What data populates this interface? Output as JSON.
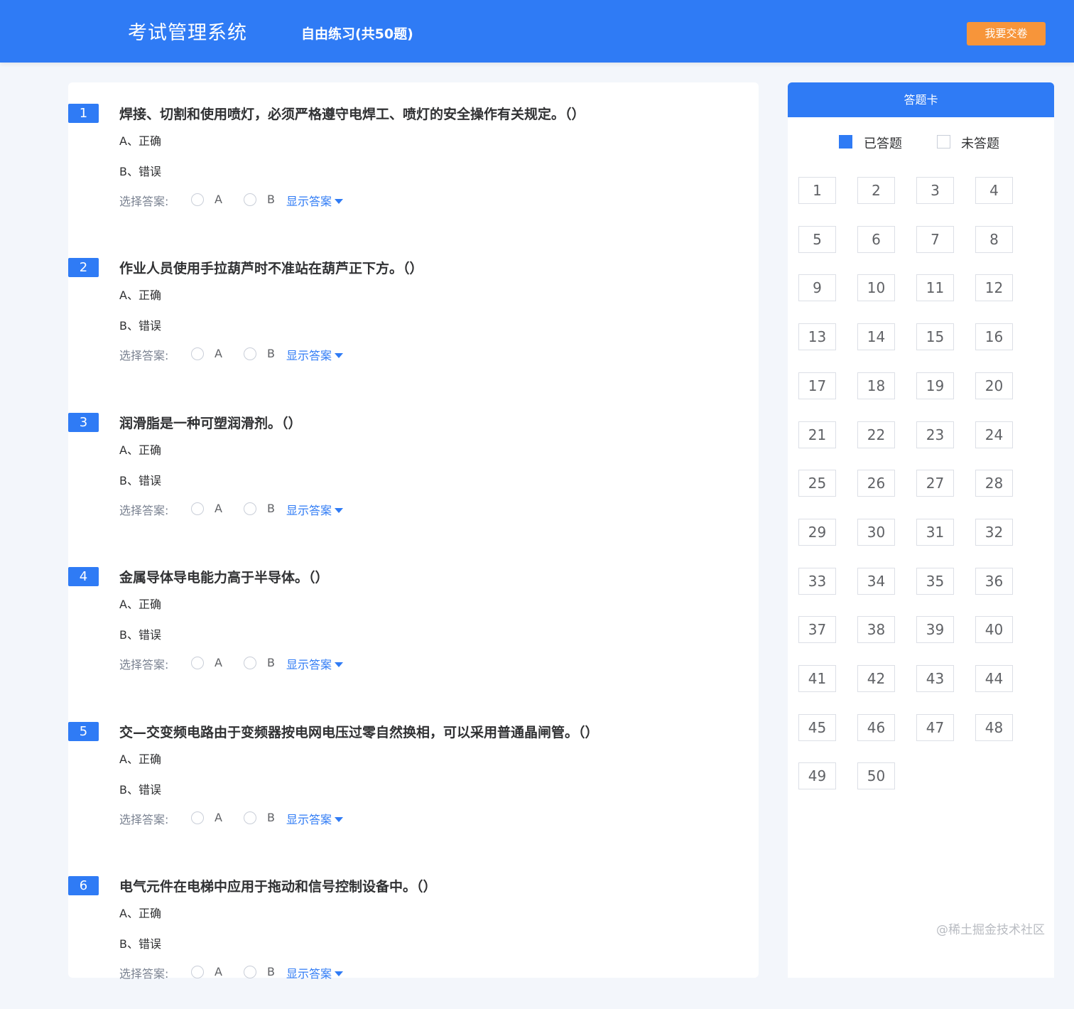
{
  "header": {
    "app_title": "考试管理系统",
    "mode_title": "自由练习(共50题)",
    "submit_label": "我要交卷"
  },
  "questions": [
    {
      "num": "1",
      "text": "焊接、切割和使用喷灯，必须严格遵守电焊工、喷灯的安全操作有关规定。（）",
      "opt_a": "A、正确",
      "opt_b": "B、错误"
    },
    {
      "num": "2",
      "text": "作业人员使用手拉葫芦时不准站在葫芦正下方。（）",
      "opt_a": "A、正确",
      "opt_b": "B、错误"
    },
    {
      "num": "3",
      "text": "润滑脂是一种可塑润滑剂。（）",
      "opt_a": "A、正确",
      "opt_b": "B、错误"
    },
    {
      "num": "4",
      "text": "金属导体导电能力高于半导体。（）",
      "opt_a": "A、正确",
      "opt_b": "B、错误"
    },
    {
      "num": "5",
      "text": "交—交变频电路由于变频器按电网电压过零自然换相，可以采用普通晶闸管。（）",
      "opt_a": "A、正确",
      "opt_b": "B、错误"
    },
    {
      "num": "6",
      "text": "电气元件在电梯中应用于拖动和信号控制设备中。（）",
      "opt_a": "A、正确",
      "opt_b": "B、错误"
    }
  ],
  "answer_row": {
    "label": "选择答案:",
    "radio_a": "A",
    "radio_b": "B",
    "show_answer": "显示答案"
  },
  "answer_card": {
    "title": "答题卡",
    "legend_done": "已答题",
    "legend_todo": "未答题",
    "numbers": [
      "1",
      "2",
      "3",
      "4",
      "5",
      "6",
      "7",
      "8",
      "9",
      "10",
      "11",
      "12",
      "13",
      "14",
      "15",
      "16",
      "17",
      "18",
      "19",
      "20",
      "21",
      "22",
      "23",
      "24",
      "25",
      "26",
      "27",
      "28",
      "29",
      "30",
      "31",
      "32",
      "33",
      "34",
      "35",
      "36",
      "37",
      "38",
      "39",
      "40",
      "41",
      "42",
      "43",
      "44",
      "45",
      "46",
      "47",
      "48",
      "49",
      "50"
    ]
  },
  "watermark": "@稀土掘金技术社区",
  "colors": {
    "primary": "#2f7bf5",
    "submit": "#f7953a",
    "background": "#f3f6fb"
  }
}
